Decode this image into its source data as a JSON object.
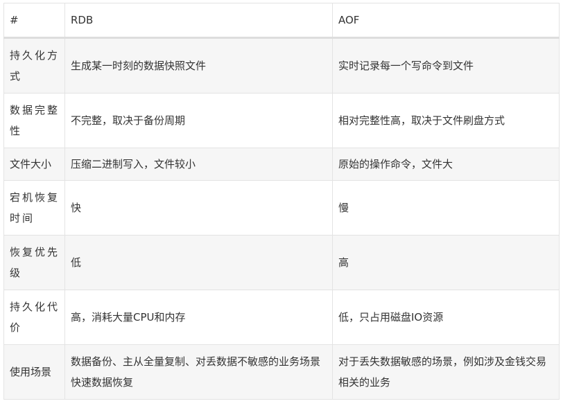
{
  "table": {
    "headers": [
      "#",
      "RDB",
      "AOF"
    ],
    "rows": [
      [
        "持久化方式",
        "生成某一时刻的数据快照文件",
        "实时记录每一个写命令到文件"
      ],
      [
        "数据完整性",
        "不完整，取决于备份周期",
        "相对完整性高，取决于文件刷盘方式"
      ],
      [
        "文件大小",
        "压缩二进制写入，文件较小",
        "原始的操作命令，文件大"
      ],
      [
        "宕机恢复时间",
        "快",
        "慢"
      ],
      [
        "恢复优先级",
        "低",
        "高"
      ],
      [
        "持久化代价",
        "高，消耗大量CPU和内存",
        "低，只占用磁盘IO资源"
      ],
      [
        "使用场景",
        "数据备份、主从全量复制、对丢数据不敏感的业务场景快速数据恢复",
        "对于丢失数据敏感的场景，例如涉及金钱交易相关的业务"
      ]
    ]
  }
}
